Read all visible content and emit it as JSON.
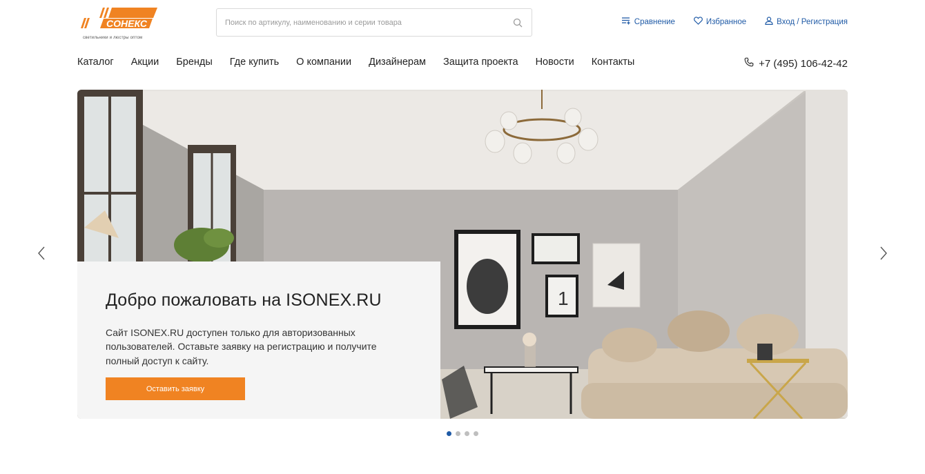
{
  "header": {
    "logo_text": "СОНЕКС",
    "logo_tagline": "светильники и люстры оптом",
    "search_placeholder": "Поиск по артикулу, наименованию и серии товара",
    "links": {
      "compare": "Сравнение",
      "favorites": "Избранное",
      "login": "Вход / Регистрация"
    },
    "icons": {
      "compare": "compare-list-icon",
      "favorites": "heart-icon",
      "login": "user-icon",
      "search": "search-icon",
      "phone": "phone-icon"
    }
  },
  "nav": {
    "items": [
      "Каталог",
      "Акции",
      "Бренды",
      "Где купить",
      "О компании",
      "Дизайнерам",
      "Защита проекта",
      "Новости",
      "Контакты"
    ],
    "phone": "+7 (495) 106-42-42"
  },
  "hero": {
    "title": "Добро пожаловать на ISONEX.RU",
    "text": "Сайт ISONEX.RU доступен только для авторизованных пользователей. Оставьте заявку на регистрацию и получите полный доступ к сайту.",
    "button": "Оставить заявку",
    "slides_total": 4,
    "active_slide": 1
  },
  "colors": {
    "accent": "#f08322",
    "link": "#1f5aa6",
    "panel_bg": "#f5f5f5"
  }
}
